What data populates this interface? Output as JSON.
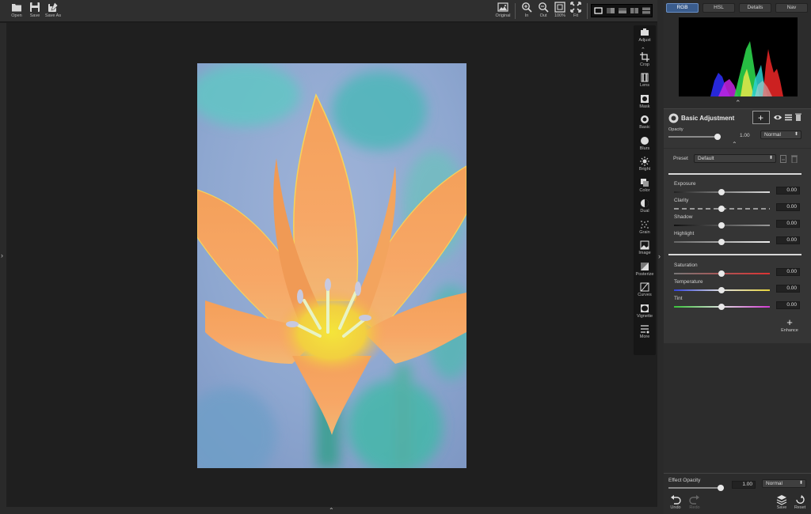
{
  "toolbar": {
    "open_label": "Open",
    "save_label": "Save",
    "save_as_label": "Save As",
    "original_label": "Original",
    "zoom_in_label": "In",
    "zoom_out_label": "Out",
    "zoom_100_label": "100%",
    "zoom_fit_label": "Fit"
  },
  "tools": [
    {
      "label": "Adjust",
      "icon": "adjust-icon"
    },
    {
      "label": "Crop",
      "icon": "crop-icon"
    },
    {
      "label": "Lens",
      "icon": "lens-icon"
    },
    {
      "label": "Mask",
      "icon": "mask-icon"
    },
    {
      "label": "Basic",
      "icon": "basic-icon"
    },
    {
      "label": "Blurs",
      "icon": "blur-icon"
    },
    {
      "label": "Bright",
      "icon": "bright-icon"
    },
    {
      "label": "Color",
      "icon": "color-icon"
    },
    {
      "label": "Dual",
      "icon": "dual-icon"
    },
    {
      "label": "Grain",
      "icon": "grain-icon"
    },
    {
      "label": "Image",
      "icon": "image-icon"
    },
    {
      "label": "Posterize",
      "icon": "posterize-icon"
    },
    {
      "label": "Curves",
      "icon": "curves-icon"
    },
    {
      "label": "Vignette",
      "icon": "vignette-icon"
    },
    {
      "label": "More",
      "icon": "more-icon"
    }
  ],
  "panel": {
    "tabs": [
      {
        "label": "RGB",
        "active": true
      },
      {
        "label": "HSL",
        "active": false
      },
      {
        "label": "Details",
        "active": false
      },
      {
        "label": "Nav",
        "active": false
      }
    ],
    "adjustment": {
      "title": "Basic Adjustment",
      "opacity_label": "Opacity",
      "opacity_value": "1.00",
      "opacity_fraction": 1.0,
      "blend_mode": "Normal"
    },
    "preset": {
      "label": "Preset",
      "value": "Default"
    },
    "sliders_group1": [
      {
        "label": "Exposure",
        "value": "0.00"
      },
      {
        "label": "Clarity",
        "value": "0.00"
      },
      {
        "label": "Shadow",
        "value": "0.00"
      },
      {
        "label": "Highlight",
        "value": "0.00"
      }
    ],
    "sliders_group2": [
      {
        "label": "Saturation",
        "value": "0.00"
      },
      {
        "label": "Temperature",
        "value": "0.00"
      },
      {
        "label": "Tint",
        "value": "0.00"
      }
    ],
    "enhance_label": "Enhance",
    "footer": {
      "effect_opacity_label": "Effect Opacity",
      "effect_opacity_value": "1.00",
      "effect_opacity_fraction": 1.0,
      "blend_mode": "Normal",
      "undo_label": "Undo",
      "redo_label": "Redo",
      "save_label": "Save",
      "reset_label": "Reset"
    }
  },
  "colors": {
    "accent": "#3a5c8c",
    "panel_bg": "#2c2c2c",
    "canvas_bg": "#1f1f1f"
  }
}
